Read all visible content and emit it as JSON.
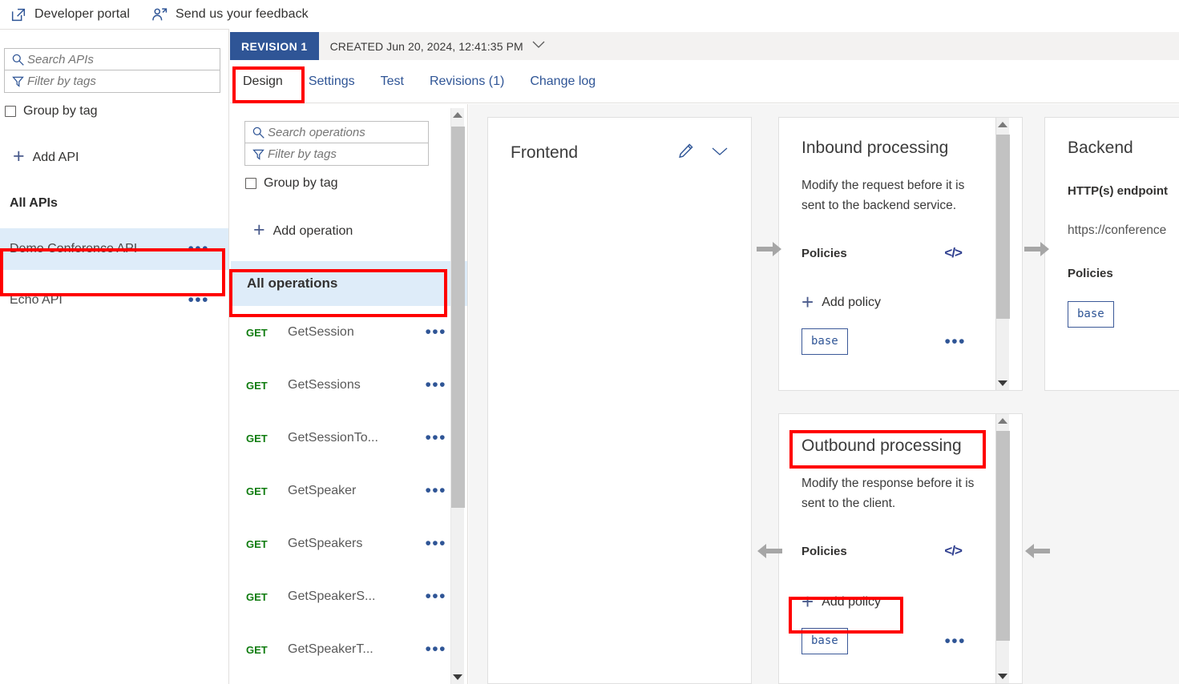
{
  "topbar": {
    "items": [
      {
        "label": "Developer portal",
        "icon": "external-link-icon"
      },
      {
        "label": "Send us your feedback",
        "icon": "feedback-person-icon"
      }
    ]
  },
  "sidebar": {
    "search_placeholder": "Search APIs",
    "search_value": "",
    "filter_placeholder": "Filter by tags",
    "filter_value": "",
    "group_by_tag_label": "Group by tag",
    "add_api_label": "Add API",
    "all_apis_label": "All APIs",
    "apis": [
      {
        "name": "Demo Conference API",
        "selected": true
      },
      {
        "name": "Echo API",
        "selected": false
      }
    ],
    "more_glyph": "•••"
  },
  "revision": {
    "tag": "REVISION 1",
    "created": "CREATED Jun 20, 2024, 12:41:35 PM"
  },
  "tabs": [
    {
      "label": "Design",
      "active": true
    },
    {
      "label": "Settings",
      "active": false
    },
    {
      "label": "Test",
      "active": false
    },
    {
      "label": "Revisions (1)",
      "active": false
    },
    {
      "label": "Change log",
      "active": false
    }
  ],
  "operations": {
    "search_placeholder": "Search operations",
    "search_value": "",
    "filter_placeholder": "Filter by tags",
    "filter_value": "",
    "group_by_tag_label": "Group by tag",
    "add_operation_label": "Add operation",
    "all_operations_label": "All operations",
    "more_glyph": "•••",
    "items": [
      {
        "verb": "GET",
        "name": "GetSession"
      },
      {
        "verb": "GET",
        "name": "GetSessions"
      },
      {
        "verb": "GET",
        "name": "GetSessionTo..."
      },
      {
        "verb": "GET",
        "name": "GetSpeaker"
      },
      {
        "verb": "GET",
        "name": "GetSpeakers"
      },
      {
        "verb": "GET",
        "name": "GetSpeakerS..."
      },
      {
        "verb": "GET",
        "name": "GetSpeakerT..."
      }
    ]
  },
  "design": {
    "frontend": {
      "title": "Frontend"
    },
    "inbound": {
      "title": "Inbound processing",
      "description": "Modify the request before it is sent to the backend service.",
      "policies_label": "Policies",
      "code_glyph": "</>",
      "add_policy_label": "Add policy",
      "chip": "base",
      "more_glyph": "•••"
    },
    "outbound": {
      "title": "Outbound processing",
      "description": "Modify the response before it is sent to the client.",
      "policies_label": "Policies",
      "code_glyph": "</>",
      "add_policy_label": "Add policy",
      "chip": "base",
      "more_glyph": "•••"
    },
    "backend": {
      "title": "Backend",
      "endpoint_label": "HTTP(s) endpoint",
      "endpoint_value": "https://conference",
      "policies_label": "Policies",
      "chip": "base"
    }
  },
  "colors": {
    "accent": "#2f5596",
    "highlight": "#ff0000",
    "selected_bg": "#deecf9",
    "verb_get": "#107c10",
    "canvas_bg": "#f5f5f5"
  }
}
